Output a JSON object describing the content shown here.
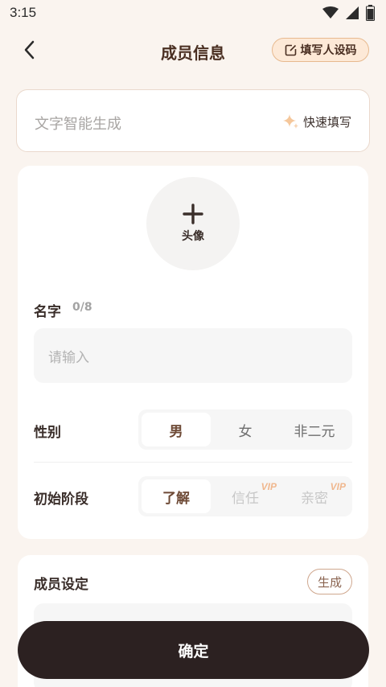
{
  "status_bar": {
    "time": "3:15"
  },
  "header": {
    "title": "成员信息",
    "persona_button_label": "填写人设码"
  },
  "smart_input": {
    "placeholder": "文字智能生成",
    "quick_fill_label": "快速填写"
  },
  "avatar": {
    "label": "头像"
  },
  "name_field": {
    "label": "名字",
    "count": "0/8",
    "placeholder": "请输入"
  },
  "gender": {
    "label": "性别",
    "options": [
      "男",
      "女",
      "非二元"
    ],
    "selected": "男"
  },
  "stage": {
    "label": "初始阶段",
    "options": [
      {
        "label": "了解",
        "vip": ""
      },
      {
        "label": "信任",
        "vip": "VIP"
      },
      {
        "label": "亲密",
        "vip": "VIP"
      }
    ],
    "selected": "了解"
  },
  "member_setting": {
    "label": "成员设定",
    "generate_label": "生成"
  },
  "confirm_label": "确定",
  "colors": {
    "accent": "#6e4a36",
    "button_dark": "#2c2121",
    "vip": "#f0b88f"
  },
  "icons": [
    "wifi-icon",
    "signal-icon",
    "battery-icon",
    "back-arrow-icon",
    "edit-icon",
    "sparkle-icon",
    "plus-icon"
  ]
}
